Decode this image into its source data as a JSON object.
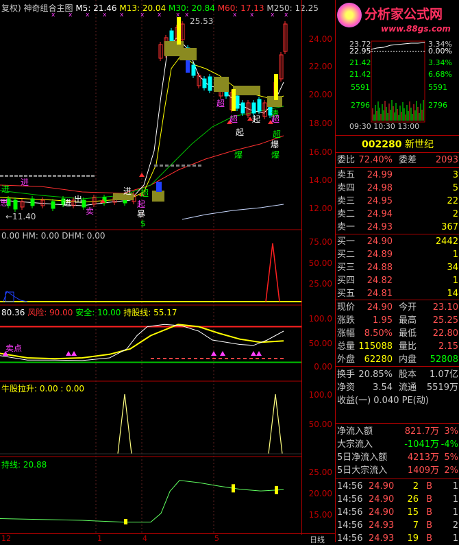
{
  "header": {
    "prefix": "复权) 神奇组合主图",
    "m5": "M5: 21.46",
    "m13": "M13: 20.04",
    "m30": "M30: 20.84",
    "m60": "M60: 17.13",
    "m250": "M250: 12.25",
    "high_label": "25.53",
    "low_label": "←11.40"
  },
  "main_axis": [
    "24.00",
    "22.00",
    "20.00",
    "18.00",
    "16.00",
    "14.00",
    "12.00"
  ],
  "signals": [
    "进",
    "超",
    "起",
    "爆",
    "超",
    "起",
    "爆",
    "卖",
    "出",
    "清",
    "进",
    "进",
    "超",
    "起",
    "暴",
    "$",
    "超",
    "进",
    "超",
    "思",
    "爆"
  ],
  "panel2": {
    "title": "0.00  HM: 0.00  DHM: 0.00",
    "axis": [
      "75.00",
      "50.00",
      "25.00"
    ]
  },
  "panel3": {
    "title_a": " 80.36",
    "title_b": "风险: 90.00",
    "title_c": "安全: 10.00",
    "title_d": "持股线: 55.17",
    "note": "卖点",
    "axis": [
      "100.0",
      "50.00",
      "0.00"
    ]
  },
  "panel4": {
    "title": "牛股拉升: 0.00 : 0.00",
    "axis": [
      "100.0",
      "50.00"
    ]
  },
  "panel5": {
    "title": "持线: 20.88",
    "axis": [
      "25.00",
      "20.00",
      "15.00"
    ]
  },
  "bottom_axis": {
    "labels": [
      "12",
      "1",
      "4",
      "5"
    ],
    "period": "日线"
  },
  "logo": {
    "title": "分析家公式网",
    "url": "www.88gs.com"
  },
  "mini": {
    "left": [
      "22.95",
      "21.42",
      "5591",
      "2796"
    ],
    "right": [
      "0.00%",
      "3.34%",
      "6.68%",
      "5591",
      "2796"
    ],
    "top_left": "23.72",
    "top_right": "3.34%",
    "times": "09:30 10:30 13:00"
  },
  "stock": {
    "code": "002280",
    "name": "新世纪"
  },
  "order": {
    "wb_label": "委比",
    "wb_value": "72.40%",
    "wc_label": "委差",
    "wc_value": "2093",
    "sells": [
      {
        "label": "卖五",
        "price": "24.99",
        "vol": "3"
      },
      {
        "label": "卖四",
        "price": "24.98",
        "vol": "5"
      },
      {
        "label": "卖三",
        "price": "24.95",
        "vol": "22"
      },
      {
        "label": "卖二",
        "price": "24.94",
        "vol": "2"
      },
      {
        "label": "卖一",
        "price": "24.93",
        "vol": "367"
      }
    ],
    "buys": [
      {
        "label": "买一",
        "price": "24.90",
        "vol": "2442"
      },
      {
        "label": "买二",
        "price": "24.89",
        "vol": "1"
      },
      {
        "label": "买三",
        "price": "24.88",
        "vol": "34"
      },
      {
        "label": "买四",
        "price": "24.82",
        "vol": "1"
      },
      {
        "label": "买五",
        "price": "24.81",
        "vol": "14"
      }
    ]
  },
  "quote": [
    {
      "l1": "现价",
      "v1": "24.90",
      "l2": "今开",
      "v2": "23.10",
      "c2": "#ff5050"
    },
    {
      "l1": "涨跌",
      "v1": "1.95",
      "l2": "最高",
      "v2": "25.25",
      "c2": "#ff5050"
    },
    {
      "l1": "涨幅",
      "v1": "8.50%",
      "l2": "最低",
      "v2": "22.80",
      "c2": "#ff5050"
    },
    {
      "l1": "总量",
      "v1": "115088",
      "l2": "量比",
      "v2": "2.15",
      "c2": "#ff5050"
    },
    {
      "l1": "外盘",
      "v1": "62280",
      "l2": "内盘",
      "v2": "52808",
      "c2": "#00ff00"
    }
  ],
  "info": [
    {
      "l1": "换手",
      "v1": "20.85%",
      "l2": "股本",
      "v2": "1.07亿"
    },
    {
      "l1": "净资",
      "v1": "3.54",
      "l2": "流通",
      "v2": "5519万"
    }
  ],
  "eps": "收益(一) 0.040  PE(动)",
  "flow": [
    {
      "label": "净流入额",
      "value": "821.7万",
      "pct": "3%",
      "color": "#ff5050"
    },
    {
      "label": "大宗流入",
      "value": "-1041万",
      "pct": "-4%",
      "color": "#00ff00"
    },
    {
      "label": "5日净流入额",
      "value": "4213万",
      "pct": "5%",
      "color": "#ff5050"
    },
    {
      "label": "5日大宗流入",
      "value": "1409万",
      "pct": "2%",
      "color": "#ff5050"
    }
  ],
  "ticks": [
    {
      "time": "14:56",
      "price": "24.90",
      "vol": "2",
      "side": "B",
      "n": "1"
    },
    {
      "time": "14:56",
      "price": "24.90",
      "vol": "26",
      "side": "B",
      "n": "1"
    },
    {
      "time": "14:56",
      "price": "24.90",
      "vol": "15",
      "side": "B",
      "n": "1"
    },
    {
      "time": "14:56",
      "price": "24.93",
      "vol": "7",
      "side": "B",
      "n": "2"
    },
    {
      "time": "14:56",
      "price": "24.93",
      "vol": "19",
      "side": "B",
      "n": "1"
    }
  ]
}
